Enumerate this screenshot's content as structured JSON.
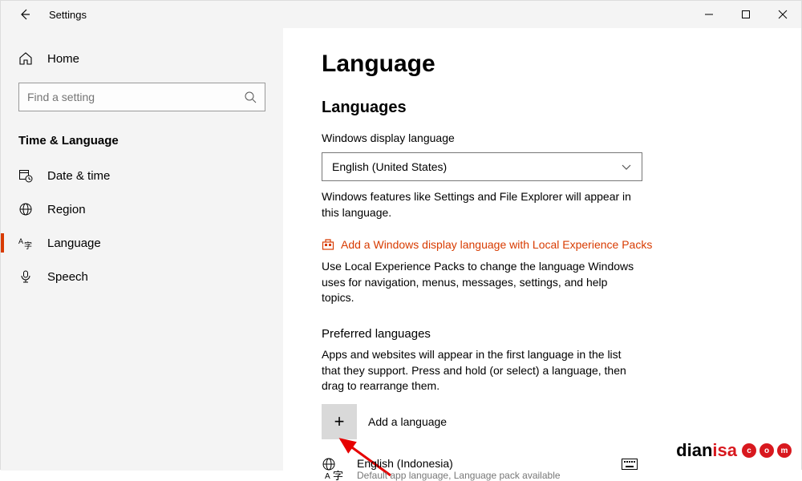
{
  "window": {
    "title": "Settings"
  },
  "sidebar": {
    "home": "Home",
    "search_placeholder": "Find a setting",
    "category": "Time & Language",
    "items": [
      {
        "label": "Date & time"
      },
      {
        "label": "Region"
      },
      {
        "label": "Language"
      },
      {
        "label": "Speech"
      }
    ]
  },
  "page": {
    "title": "Language",
    "section1_title": "Languages",
    "display_lang_label": "Windows display language",
    "display_lang_value": "English (United States)",
    "display_lang_desc": "Windows features like Settings and File Explorer will appear in this language.",
    "store_link": "Add a Windows display language with Local Experience Packs",
    "lep_desc": "Use Local Experience Packs to change the language Windows uses for navigation, menus, messages, settings, and help topics.",
    "preferred_title": "Preferred languages",
    "preferred_desc": "Apps and websites will appear in the first language in the list that they support. Press and hold (or select) a language, then drag to rearrange them.",
    "add_label": "Add a language",
    "langs": [
      {
        "name": "English (Indonesia)",
        "sub": "Default app language, Language pack available"
      }
    ]
  },
  "watermark": {
    "part1": "dian",
    "part2": "isa",
    "dots": [
      "c",
      "o",
      "m"
    ]
  }
}
